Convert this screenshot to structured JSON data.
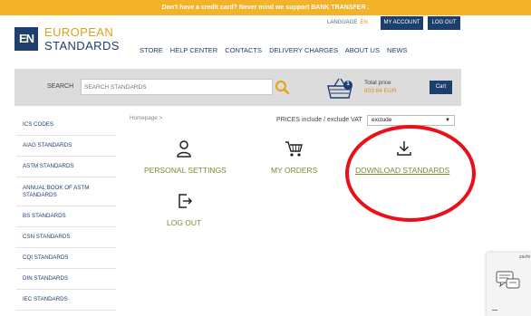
{
  "promo": {
    "text": "Don't have a credit card? Never mind we support BANK TRANSFER ."
  },
  "logo": {
    "mark": "EN",
    "line1": "EUROPEAN",
    "line2": "STANDARDS"
  },
  "header": {
    "language_label": "LANGUAGE",
    "language_code": "EN",
    "my_account": "MY ACCOUNT",
    "logout": "LOG OUT"
  },
  "nav": [
    {
      "label": "STORE"
    },
    {
      "label": "HELP CENTER"
    },
    {
      "label": "CONTACTS"
    },
    {
      "label": "DELIVERY CHARGES"
    },
    {
      "label": "ABOUT US"
    },
    {
      "label": "NEWS"
    }
  ],
  "search": {
    "label": "SEARCH",
    "placeholder": "SEARCH STANDARDS",
    "icon": "magnifier-icon"
  },
  "cart": {
    "count": "1",
    "price_label": "Total price",
    "price_value": "803.64 EUR",
    "button": "Cart",
    "icon": "shopping-basket-icon"
  },
  "sidebar": [
    {
      "label": "ICS CODES"
    },
    {
      "label": "AIAG STANDARDS"
    },
    {
      "label": "ASTM STANDARDS"
    },
    {
      "label": "ANNUAL BOOK OF ASTM STANDARDS"
    },
    {
      "label": "BS STANDARDS"
    },
    {
      "label": "CSN STANDARDS"
    },
    {
      "label": "CQI STANDARDS"
    },
    {
      "label": "DIN STANDARDS"
    },
    {
      "label": "IEC STANDARDS"
    }
  ],
  "breadcrumb": {
    "home": "Homepage",
    "sep": ">"
  },
  "prices": {
    "label": "PRICES include / exclude VAT",
    "selected": "exclude"
  },
  "actions": {
    "personal_settings": "PERSONAL SETTINGS",
    "my_orders": "MY ORDERS",
    "download_standards": "DOWNLOAD STANDARDS",
    "log_out": "LOG OUT"
  },
  "chat": {
    "text": "zavře",
    "icon": "chat-bubbles-icon"
  },
  "colors": {
    "brand_blue": "#1c3f6e",
    "brand_gold": "#d9a21b",
    "promo_bar": "#f2b32a",
    "action_green": "#7a8e2c",
    "price_orange": "#e38b1a",
    "annotation_red": "#e8101b"
  }
}
